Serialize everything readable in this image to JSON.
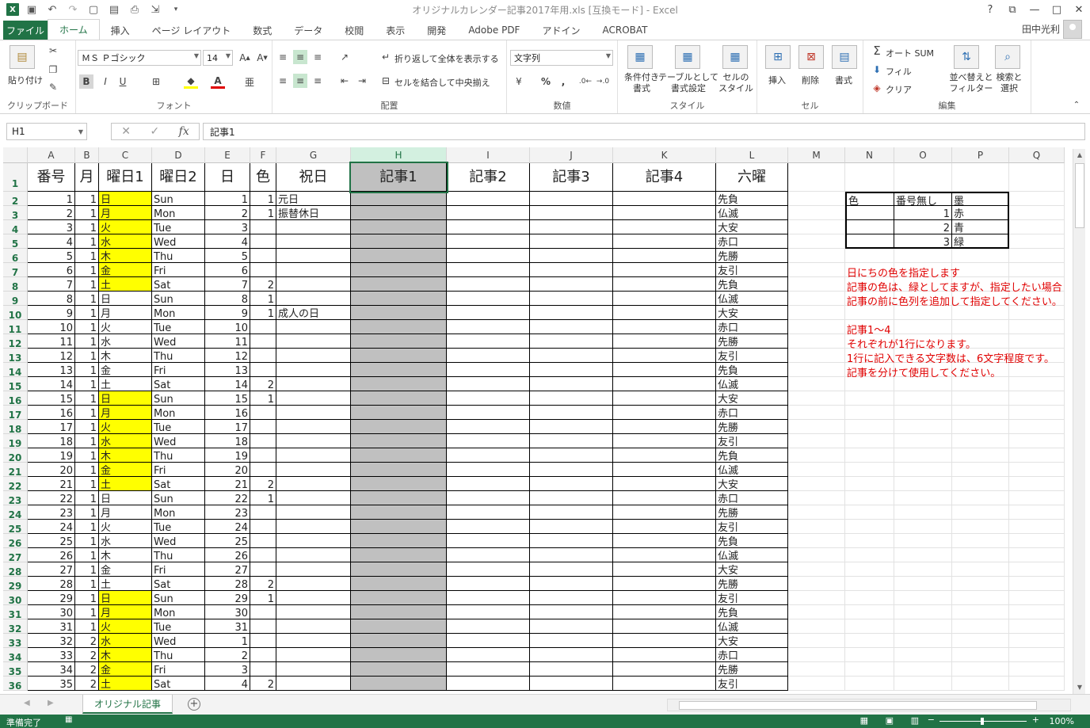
{
  "app": {
    "title": "オリジナルカレンダー記事2017年用.xls  [互換モード] - Excel",
    "user_name": "田中光利",
    "file_tab": "ファイル",
    "tabs": [
      "ホーム",
      "挿入",
      "ページ レイアウト",
      "数式",
      "データ",
      "校閲",
      "表示",
      "開発",
      "Adobe PDF",
      "アドイン",
      "ACROBAT"
    ],
    "active_tab": "ホーム",
    "help": "?",
    "window_buttons": [
      "?",
      "⧉",
      "—",
      "□",
      "✕"
    ]
  },
  "ribbon": {
    "clipboard": {
      "paste": "貼り付け",
      "label": "クリップボード"
    },
    "font": {
      "font_name": "ＭＳ Ｐゴシック",
      "font_size": "14",
      "bold": "B",
      "italic": "I",
      "underline": "U",
      "label": "フォント"
    },
    "alignment": {
      "wrap_text": "折り返して全体を表示する",
      "merge_center": "セルを結合して中央揃え",
      "label": "配置"
    },
    "number": {
      "format": "文字列",
      "percent": "%",
      "comma": ",",
      "label": "数値"
    },
    "styles": {
      "conditional": "条件付き\n書式",
      "table": "テーブルとして\n書式設定",
      "cell_styles": "セルの\nスタイル",
      "label": "スタイル"
    },
    "cells": {
      "insert": "挿入",
      "delete": "削除",
      "format": "書式",
      "label": "セル"
    },
    "editing": {
      "autosum": "オート SUM",
      "fill": "フィル",
      "clear": "クリア",
      "sort_filter": "並べ替えと\nフィルター",
      "find_select": "検索と\n選択",
      "label": "編集"
    }
  },
  "formula_bar": {
    "name_box": "H1",
    "formula": "記事1"
  },
  "grid": {
    "columns": [
      "A",
      "B",
      "C",
      "D",
      "E",
      "F",
      "G",
      "H",
      "I",
      "J",
      "K",
      "L",
      "M",
      "N",
      "O",
      "P",
      "Q"
    ],
    "selected_column": "H",
    "header_row": [
      "番号",
      "月",
      "曜日1",
      "曜日2",
      "日",
      "色",
      "祝日",
      "記事1",
      "記事2",
      "記事3",
      "記事4",
      "六曜"
    ],
    "rows": [
      [
        "1",
        "1",
        "日",
        "Sun",
        "1",
        "1",
        "元日",
        "先負"
      ],
      [
        "2",
        "1",
        "月",
        "Mon",
        "2",
        "1",
        "振替休日",
        "仏滅"
      ],
      [
        "3",
        "1",
        "火",
        "Tue",
        "3",
        "",
        "",
        "大安"
      ],
      [
        "4",
        "1",
        "水",
        "Wed",
        "4",
        "",
        "",
        "赤口"
      ],
      [
        "5",
        "1",
        "木",
        "Thu",
        "5",
        "",
        "",
        "先勝"
      ],
      [
        "6",
        "1",
        "金",
        "Fri",
        "6",
        "",
        "",
        "友引"
      ],
      [
        "7",
        "1",
        "土",
        "Sat",
        "7",
        "2",
        "",
        "先負"
      ],
      [
        "8",
        "1",
        "日",
        "Sun",
        "8",
        "1",
        "",
        "仏滅"
      ],
      [
        "9",
        "1",
        "月",
        "Mon",
        "9",
        "1",
        "成人の日",
        "大安"
      ],
      [
        "10",
        "1",
        "火",
        "Tue",
        "10",
        "",
        "",
        "赤口"
      ],
      [
        "11",
        "1",
        "水",
        "Wed",
        "11",
        "",
        "",
        "先勝"
      ],
      [
        "12",
        "1",
        "木",
        "Thu",
        "12",
        "",
        "",
        "友引"
      ],
      [
        "13",
        "1",
        "金",
        "Fri",
        "13",
        "",
        "",
        "先負"
      ],
      [
        "14",
        "1",
        "土",
        "Sat",
        "14",
        "2",
        "",
        "仏滅"
      ],
      [
        "15",
        "1",
        "日",
        "Sun",
        "15",
        "1",
        "",
        "大安"
      ],
      [
        "16",
        "1",
        "月",
        "Mon",
        "16",
        "",
        "",
        "赤口"
      ],
      [
        "17",
        "1",
        "火",
        "Tue",
        "17",
        "",
        "",
        "先勝"
      ],
      [
        "18",
        "1",
        "水",
        "Wed",
        "18",
        "",
        "",
        "友引"
      ],
      [
        "19",
        "1",
        "木",
        "Thu",
        "19",
        "",
        "",
        "先負"
      ],
      [
        "20",
        "1",
        "金",
        "Fri",
        "20",
        "",
        "",
        "仏滅"
      ],
      [
        "21",
        "1",
        "土",
        "Sat",
        "21",
        "2",
        "",
        "大安"
      ],
      [
        "22",
        "1",
        "日",
        "Sun",
        "22",
        "1",
        "",
        "赤口"
      ],
      [
        "23",
        "1",
        "月",
        "Mon",
        "23",
        "",
        "",
        "先勝"
      ],
      [
        "24",
        "1",
        "火",
        "Tue",
        "24",
        "",
        "",
        "友引"
      ],
      [
        "25",
        "1",
        "水",
        "Wed",
        "25",
        "",
        "",
        "先負"
      ],
      [
        "26",
        "1",
        "木",
        "Thu",
        "26",
        "",
        "",
        "仏滅"
      ],
      [
        "27",
        "1",
        "金",
        "Fri",
        "27",
        "",
        "",
        "大安"
      ],
      [
        "28",
        "1",
        "土",
        "Sat",
        "28",
        "2",
        "",
        "先勝"
      ],
      [
        "29",
        "1",
        "日",
        "Sun",
        "29",
        "1",
        "",
        "友引"
      ],
      [
        "30",
        "1",
        "月",
        "Mon",
        "30",
        "",
        "",
        "先負"
      ],
      [
        "31",
        "1",
        "火",
        "Tue",
        "31",
        "",
        "",
        "仏滅"
      ],
      [
        "32",
        "2",
        "水",
        "Wed",
        "1",
        "",
        "",
        "大安"
      ],
      [
        "33",
        "2",
        "木",
        "Thu",
        "2",
        "",
        "",
        "赤口"
      ],
      [
        "34",
        "2",
        "金",
        "Fri",
        "3",
        "",
        "",
        "先勝"
      ],
      [
        "35",
        "2",
        "土",
        "Sat",
        "4",
        "2",
        "",
        "友引"
      ]
    ],
    "yellow_rows": [
      1,
      2,
      3,
      4,
      5,
      6,
      7,
      15,
      16,
      17,
      18,
      19,
      20,
      21,
      29,
      30,
      31,
      32,
      33,
      34,
      35
    ],
    "color_table": [
      [
        "色",
        "番号無し",
        "墨"
      ],
      [
        "",
        "1",
        "赤"
      ],
      [
        "",
        "2",
        "青"
      ],
      [
        "",
        "3",
        "緑"
      ]
    ],
    "notes": [
      "日にちの色を指定します",
      "記事の色は、緑としてますが、指定したい場合",
      "記事の前に色列を追加して指定してください。",
      "",
      "記事1～4",
      "それぞれが1行になります。",
      "1行に記入できる文字数は、6文字程度です。",
      "記事を分けて使用してください。"
    ]
  },
  "sheet_tabs": {
    "active": "オリジナル記事"
  },
  "status": {
    "ready": "準備完了",
    "zoom": "100%"
  }
}
